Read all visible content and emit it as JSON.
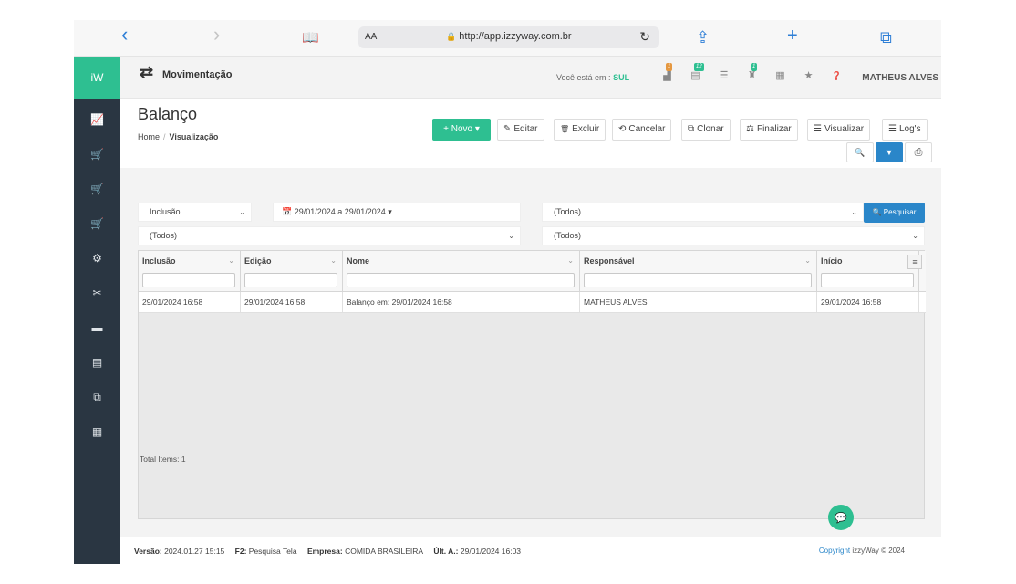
{
  "browser": {
    "back_icon": "‹",
    "forward_icon": "›",
    "bookmarks_icon": "📖",
    "aa": "AA",
    "lock": "🔒",
    "url": "http://app.izzyway.com.br",
    "reload_icon": "↻",
    "share_icon": "⇪",
    "new_tab_icon": "+",
    "tabs_icon": "⧉"
  },
  "sidebar": {
    "logo": "iW",
    "items": [
      "📈",
      "🛒",
      "🛒",
      "🛒",
      "⚙",
      "✂",
      "▬",
      "▤",
      "⧉",
      "▦"
    ]
  },
  "topbar": {
    "icon": "⇄",
    "title": "Movimentação",
    "where_label": "Você está em :",
    "where_value": "SUL",
    "icons": [
      {
        "glyph": "▟",
        "badge": "1"
      },
      {
        "glyph": "▤",
        "badge": "12"
      },
      {
        "glyph": "☰",
        "badge": ""
      },
      {
        "glyph": "♜",
        "badge": "1"
      },
      {
        "glyph": "▦",
        "badge": ""
      },
      {
        "glyph": "★",
        "badge": ""
      },
      {
        "glyph": "❓",
        "badge": ""
      }
    ],
    "user": "MATHEUS ALVES"
  },
  "page": {
    "title": "Balanço",
    "breadcrumb": {
      "home": "Home",
      "separator": "/",
      "current": "Visualização"
    }
  },
  "toolbar": {
    "new": "+ Novo ▾",
    "edit": "Editar",
    "delete": "Excluir",
    "cancel": "Cancelar",
    "clone": "Clonar",
    "finish": "Finalizar",
    "view": "Visualizar",
    "logs": "Log's",
    "edit_icon": "✎",
    "delete_icon": "🗑",
    "cancel_icon": "⟲",
    "clone_icon": "⧉",
    "finish_icon": "⚖",
    "view_icon": "☰",
    "logs_icon": "☰",
    "search_icon": "🔍",
    "filter_icon": "▼",
    "print_icon": "⎙"
  },
  "filters": {
    "date_type": "Inclusão",
    "date_range": "📅 29/01/2024 a 29/01/2024 ▾",
    "select1": "(Todos)",
    "select2": "(Todos)",
    "select3": "(Todos)",
    "search_button": "🔍 Pesquisar",
    "caret": "⌄"
  },
  "grid": {
    "columns": [
      "Inclusão",
      "Edição",
      "Nome",
      "Responsável",
      "Início"
    ],
    "chevron": "⌄",
    "menu_icon": "≡",
    "rows": [
      [
        "29/01/2024 16:58",
        "29/01/2024 16:58",
        "Balanço em: 29/01/2024 16:58",
        "MATHEUS ALVES",
        "29/01/2024 16:58"
      ]
    ],
    "total_label": "Total Items: 1"
  },
  "footer": {
    "version_label": "Versão:",
    "version_value": "2024.01.27 15:15",
    "f2_label": "F2:",
    "f2_value": "Pesquisa Tela",
    "company_label": "Empresa:",
    "company_value": "COMIDA BRASILEIRA",
    "last_label": "Últ. A.:",
    "last_value": "29/01/2024 16:03",
    "copyright_label": "Copyright",
    "copyright_value": "izzyWay © 2024",
    "chat_icon": "💬"
  }
}
